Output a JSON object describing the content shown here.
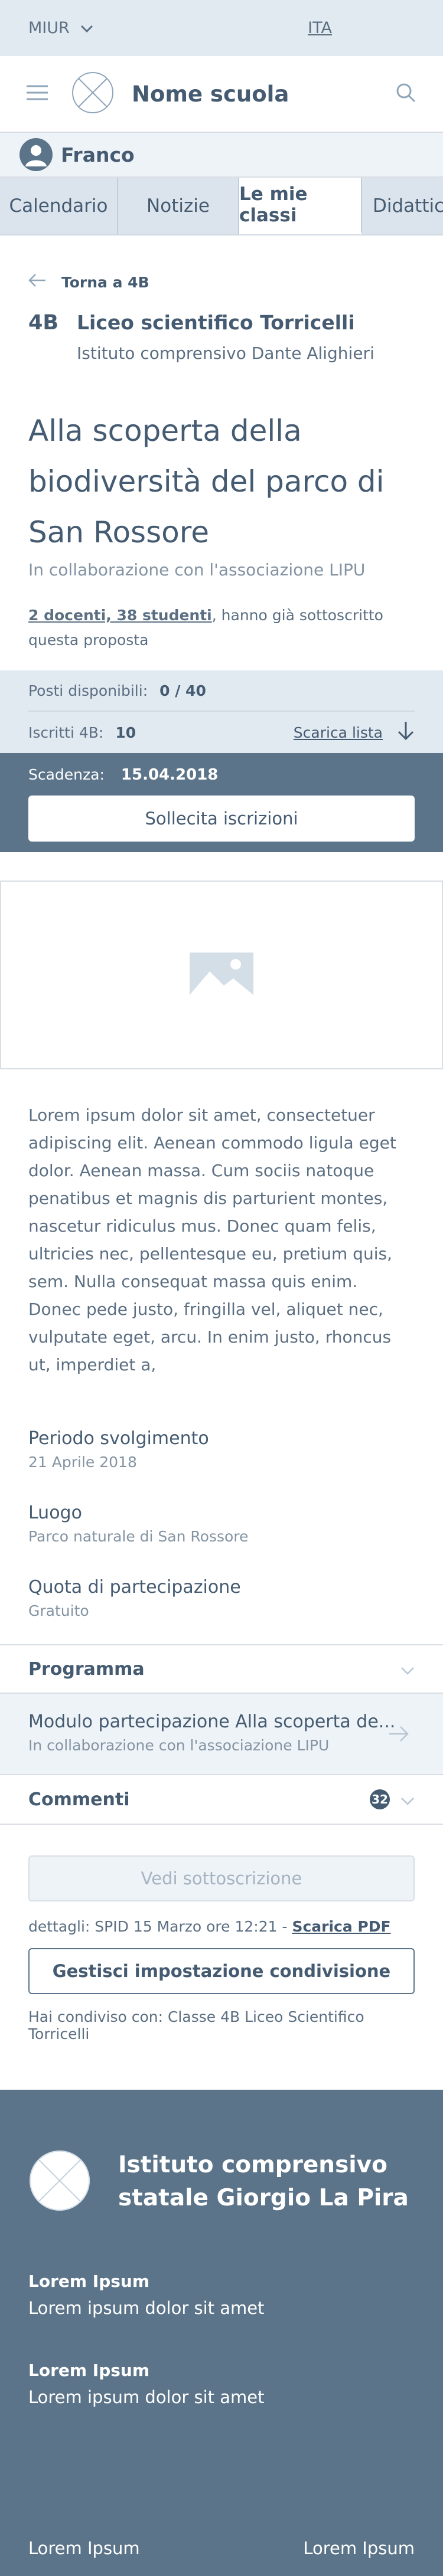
{
  "topbar": {
    "brand": "MIUR",
    "language": "ITA"
  },
  "header": {
    "school_name": "Nome scuola"
  },
  "user": {
    "name": "Franco"
  },
  "tabs": [
    {
      "label": "Calendario"
    },
    {
      "label": "Notizie"
    },
    {
      "label": "Le mie classi",
      "active": true
    },
    {
      "label": "Didattica"
    }
  ],
  "back_link": "Torna a 4B",
  "class_info": {
    "code": "4B",
    "school": "Liceo scientifico Torricelli",
    "institute": "Istituto comprensivo Dante Alighieri"
  },
  "project": {
    "title_lines": [
      "Alla scoperta della",
      "biodiversità del parco di",
      "San Rossore"
    ],
    "subtitle": "In collaborazione con l'associazione LIPU",
    "subscribed_link": "2 docenti, 38 studenti",
    "subscribed_text": ", hanno già sottoscritto questa proposta"
  },
  "stats": {
    "seats_label": "Posti disponibili:",
    "seats_value": "0 / 40",
    "enrolled_label": "Iscritti 4B:",
    "enrolled_value": "10",
    "download_label": "Scarica lista"
  },
  "deadline": {
    "label": "Scadenza:",
    "value": "15.04.2018",
    "button": "Sollecita iscrizioni"
  },
  "description": "Lorem ipsum dolor sit amet, consectetuer adipiscing elit. Aenean commodo ligula eget dolor. Aenean massa. Cum sociis natoque penatibus et magnis dis parturient montes, nascetur ridiculus mus. Donec quam felis, ultricies nec, pellentesque eu, pretium quis, sem. Nulla consequat massa quis enim. Donec pede justo, fringilla vel, aliquet nec, vulputate eget, arcu. In enim justo, rhoncus ut, imperdiet a,",
  "info": [
    {
      "label": "Periodo svolgimento",
      "value": "21 Aprile 2018"
    },
    {
      "label": "Luogo",
      "value": "Parco naturale di San Rossore"
    },
    {
      "label": "Quota di partecipazione",
      "value": "Gratuito"
    }
  ],
  "program": {
    "label": "Programma",
    "module_title": "Modulo partecipazione Alla scoperta de...",
    "module_subtitle": "In collaborazione con l'associazione LIPU"
  },
  "comments": {
    "label": "Commenti",
    "count": "32"
  },
  "actions": {
    "view_button": "Vedi sottoscrizione",
    "details_prefix": "dettagli: SPID 15 Marzo ore 12:21 - ",
    "details_link": "Scarica PDF",
    "manage_button": "Gestisci impostazione condivisione",
    "shared_with": "Hai condiviso con: Classe 4B Liceo Scientifico Torricelli"
  },
  "footer": {
    "institute_line1": "Istituto comprensivo",
    "institute_line2": "statale Giorgio La Pira",
    "blocks": [
      {
        "heading": "Lorem Ipsum",
        "text": "Lorem ipsum dolor sit amet"
      },
      {
        "heading": "Lorem Ipsum",
        "text": "Lorem ipsum dolor sit amet"
      }
    ],
    "bottom_left": "Lorem Ipsum",
    "bottom_right": "Lorem Ipsum"
  },
  "colors": {
    "primary_text": "#455b71",
    "dark_band": "#5b7489",
    "light_band": "#e1e9f1"
  }
}
